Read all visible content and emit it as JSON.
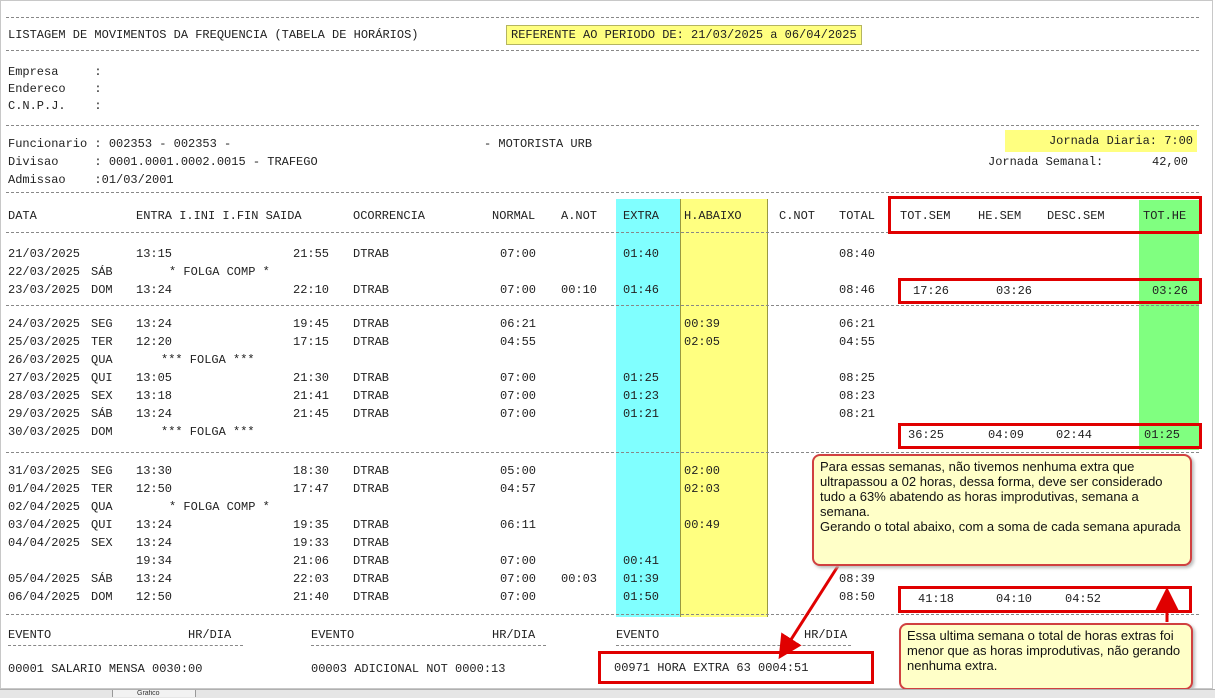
{
  "report": {
    "title": "LISTAGEM DE MOVIMENTOS DA FREQUENCIA (TABELA DE HORÁRIOS)",
    "period": "REFERENTE AO PERIODO DE: 21/03/2025 a 06/04/2025"
  },
  "company": {
    "empresa_label": "Empresa     :",
    "endereco_label": "Endereco    :",
    "cnpj_label": "C.N.P.J.    :"
  },
  "employee": {
    "funcionario": "Funcionario : 002353 - 002353 -",
    "cargo": "- MOTORISTA URB",
    "divisao": "Divisao     : 0001.0001.0002.0015 - TRAFEGO",
    "admissao": "Admissao    :01/03/2001",
    "jornada_diaria": "Jornada Diaria: 7:00",
    "jornada_semanal_label": "Jornada Semanal:",
    "jornada_semanal_value": "42,00"
  },
  "table": {
    "headers": {
      "data": "DATA",
      "entra": "ENTRA I.INI I.FIN SAIDA",
      "ocorrencia": "OCORRENCIA",
      "normal": "NORMAL",
      "anot": "A.NOT",
      "extra": "EXTRA",
      "habaixo": "H.ABAIXO",
      "cnot": "C.NOT",
      "total": "TOTAL",
      "totsem": "TOT.SEM",
      "hesem": "HE.SEM",
      "descsem": "DESC.SEM",
      "tothe": "TOT.HE"
    },
    "rows": [
      {
        "date": "21/03/2025",
        "day": "",
        "entra": "13:15",
        "saida": "21:55",
        "oc": "DTRAB",
        "normal": "07:00",
        "anot": "",
        "extra": "01:40",
        "habaixo": "",
        "total": "08:40"
      },
      {
        "date": "22/03/2025",
        "day": "SÁB",
        "entra": "",
        "saida": "",
        "oc": "* FOLGA COMP *",
        "normal": "",
        "anot": "",
        "extra": "",
        "habaixo": "",
        "total": ""
      },
      {
        "date": "23/03/2025",
        "day": "DOM",
        "entra": "13:24",
        "saida": "22:10",
        "oc": "DTRAB",
        "normal": "07:00",
        "anot": "00:10",
        "extra": "01:46",
        "habaixo": "",
        "total": "08:46"
      },
      {
        "date": "24/03/2025",
        "day": "SEG",
        "entra": "13:24",
        "saida": "19:45",
        "oc": "DTRAB",
        "normal": "06:21",
        "anot": "",
        "extra": "",
        "habaixo": "00:39",
        "total": "06:21"
      },
      {
        "date": "25/03/2025",
        "day": "TER",
        "entra": "12:20",
        "saida": "17:15",
        "oc": "DTRAB",
        "normal": "04:55",
        "anot": "",
        "extra": "",
        "habaixo": "02:05",
        "total": "04:55"
      },
      {
        "date": "26/03/2025",
        "day": "QUA",
        "entra": "",
        "saida": "",
        "oc": "*** FOLGA ***",
        "normal": "",
        "anot": "",
        "extra": "",
        "habaixo": "",
        "total": ""
      },
      {
        "date": "27/03/2025",
        "day": "QUI",
        "entra": "13:05",
        "saida": "21:30",
        "oc": "DTRAB",
        "normal": "07:00",
        "anot": "",
        "extra": "01:25",
        "habaixo": "",
        "total": "08:25"
      },
      {
        "date": "28/03/2025",
        "day": "SEX",
        "entra": "13:18",
        "saida": "21:41",
        "oc": "DTRAB",
        "normal": "07:00",
        "anot": "",
        "extra": "01:23",
        "habaixo": "",
        "total": "08:23"
      },
      {
        "date": "29/03/2025",
        "day": "SÁB",
        "entra": "13:24",
        "saida": "21:45",
        "oc": "DTRAB",
        "normal": "07:00",
        "anot": "",
        "extra": "01:21",
        "habaixo": "",
        "total": "08:21"
      },
      {
        "date": "30/03/2025",
        "day": "DOM",
        "entra": "",
        "saida": "",
        "oc": "*** FOLGA ***",
        "normal": "",
        "anot": "",
        "extra": "",
        "habaixo": "",
        "total": ""
      },
      {
        "date": "31/03/2025",
        "day": "SEG",
        "entra": "13:30",
        "saida": "18:30",
        "oc": "DTRAB",
        "normal": "05:00",
        "anot": "",
        "extra": "",
        "habaixo": "02:00",
        "total": ""
      },
      {
        "date": "01/04/2025",
        "day": "TER",
        "entra": "12:50",
        "saida": "17:47",
        "oc": "DTRAB",
        "normal": "04:57",
        "anot": "",
        "extra": "",
        "habaixo": "02:03",
        "total": ""
      },
      {
        "date": "02/04/2025",
        "day": "QUA",
        "entra": "",
        "saida": "",
        "oc": "* FOLGA COMP *",
        "normal": "",
        "anot": "",
        "extra": "",
        "habaixo": "",
        "total": ""
      },
      {
        "date": "03/04/2025",
        "day": "QUI",
        "entra": "13:24",
        "saida": "19:35",
        "oc": "DTRAB",
        "normal": "06:11",
        "anot": "",
        "extra": "",
        "habaixo": "00:49",
        "total": ""
      },
      {
        "date": "04/04/2025",
        "day": "SEX",
        "entra": "13:24",
        "saida": "19:33",
        "oc": "DTRAB",
        "normal": "",
        "anot": "",
        "extra": "",
        "habaixo": "",
        "total": ""
      },
      {
        "date": "",
        "day": "",
        "entra": "19:34",
        "saida": "21:06",
        "oc": "DTRAB",
        "normal": "07:00",
        "anot": "",
        "extra": "00:41",
        "habaixo": "",
        "total": ""
      },
      {
        "date": "05/04/2025",
        "day": "SÁB",
        "entra": "13:24",
        "saida": "22:03",
        "oc": "DTRAB",
        "normal": "07:00",
        "anot": "00:03",
        "extra": "01:39",
        "habaixo": "",
        "total": "08:39"
      },
      {
        "date": "06/04/2025",
        "day": "DOM",
        "entra": "12:50",
        "saida": "21:40",
        "oc": "DTRAB",
        "normal": "07:00",
        "anot": "",
        "extra": "01:50",
        "habaixo": "",
        "total": "08:50"
      }
    ],
    "week_totals": [
      {
        "totsem": "17:26",
        "hesem": "03:26",
        "descsem": "",
        "tothe": "03:26"
      },
      {
        "totsem": "36:25",
        "hesem": "04:09",
        "descsem": "02:44",
        "tothe": "01:25"
      },
      {
        "totsem": "41:18",
        "hesem": "04:10",
        "descsem": "04:52",
        "tothe": ""
      }
    ]
  },
  "events": {
    "h_evento": "EVENTO",
    "h_hrdia": "HR/DIA",
    "h_hrdia3": "HR/DIA",
    "e1": "00001 SALARIO MENSA 0030:00",
    "e2": "00003 ADICIONAL NOT 0000:13",
    "e3": "00971 HORA EXTRA 63 0004:51"
  },
  "callouts": {
    "c1": "Para essas semanas, não tivemos nenhuma extra que ultrapassou a 02 horas, dessa forma, deve ser considerado tudo a 63% abatendo as horas improdutivas, semana a semana.\nGerando o total abaixo, com a soma de cada semana apurada",
    "c2": "Essa ultima semana o total de horas extras foi menor que as horas improdutivas, não gerando nenhuma extra."
  },
  "statusbar": {
    "tab_label": "Grafico"
  },
  "colors": {
    "extra_column": "#80ffff",
    "habaixo_column": "#ffff80",
    "tothe_column": "#80ff80",
    "annotation_red": "#e00000",
    "callout_fill": "#ffffc8"
  }
}
